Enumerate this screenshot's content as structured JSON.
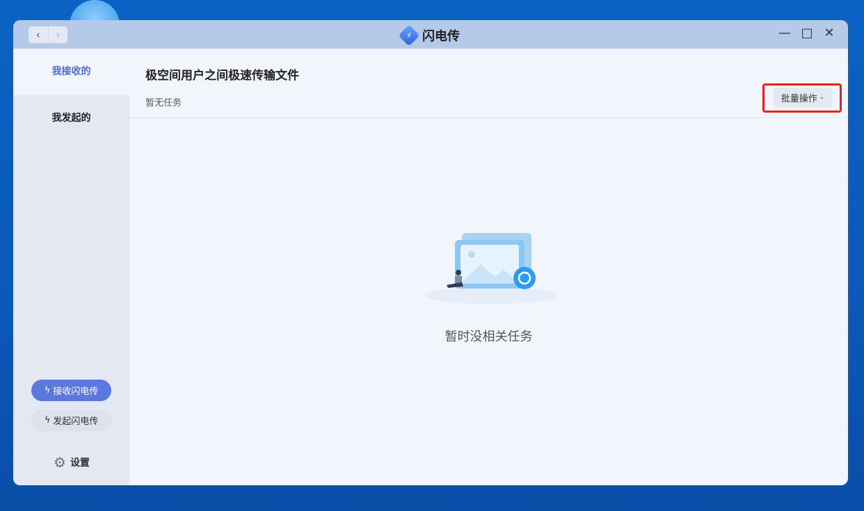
{
  "window": {
    "title": "闪电传",
    "nav_back": "‹",
    "nav_forward": "›",
    "minimize": "—",
    "maximize": "□",
    "close": "✕"
  },
  "sidebar": {
    "items": [
      {
        "label": "我接收的",
        "active": true
      },
      {
        "label": "我发起的",
        "active": false
      }
    ],
    "receive_button": "接收闪电传",
    "send_button": "发起闪电传",
    "settings": "设置"
  },
  "main": {
    "heading": "极空间用户之间极速传输文件",
    "subtitle": "暂无任务",
    "batch_button": "批量操作",
    "empty_text": "暂时没相关任务"
  },
  "colors": {
    "accent": "#5b78de",
    "highlight": "#e8211d"
  }
}
